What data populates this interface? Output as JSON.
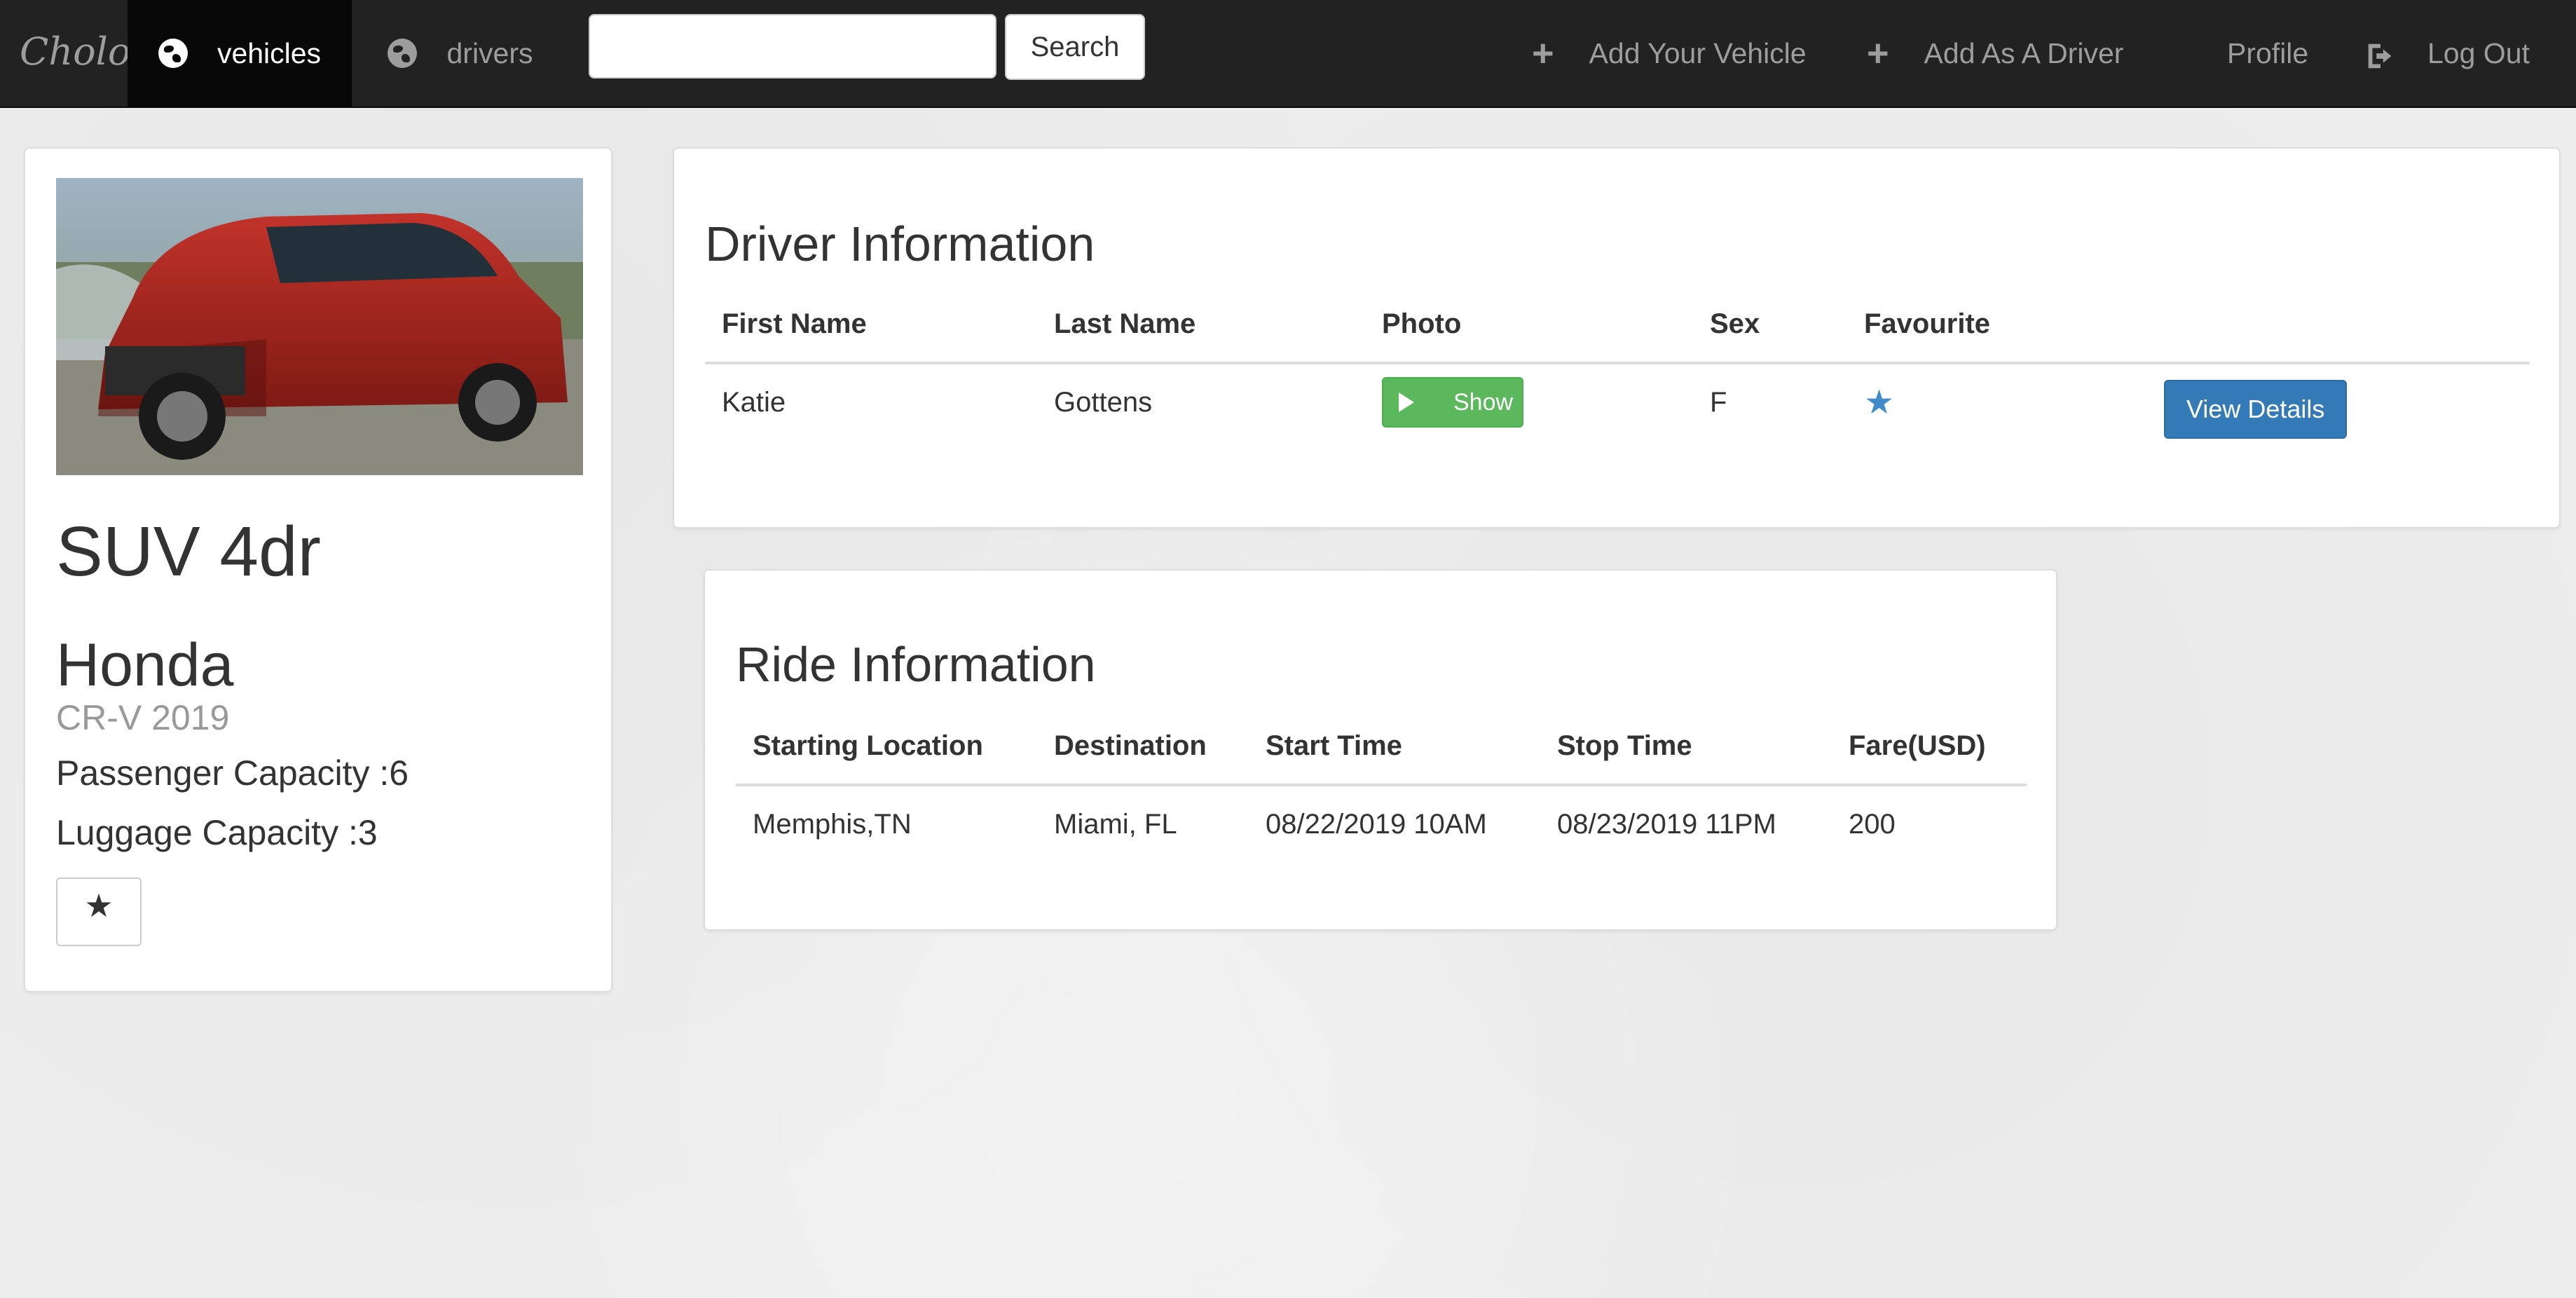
{
  "navbar": {
    "brand": "Cholo",
    "items": [
      {
        "label": "vehicles",
        "icon": "globe-icon",
        "active": true
      },
      {
        "label": "drivers",
        "icon": "globe-icon",
        "active": false
      }
    ],
    "search": {
      "placeholder": "",
      "value": "",
      "button_label": "Search"
    },
    "right_items": [
      {
        "label": "Add Your Vehicle",
        "icon": "plus-icon"
      },
      {
        "label": "Add As A Driver",
        "icon": "plus-icon"
      },
      {
        "label": "Profile"
      },
      {
        "label": "Log Out",
        "icon": "logout-icon"
      }
    ]
  },
  "vehicle": {
    "image": "car-photo (red Honda CR-V)",
    "title": "SUV 4dr",
    "make": "Honda",
    "model": "CR-V 2019",
    "passenger_capacity": "Passenger Capacity :6",
    "luggage_capacity": "Luggage Capacity :3",
    "favourite_symbol": "★"
  },
  "driver_info": {
    "title": "Driver Information",
    "columns": [
      "First Name",
      "Last Name",
      "Photo",
      "Sex",
      "Favourite",
      ""
    ],
    "rows": [
      {
        "first_name": "Katie",
        "last_name": "Gottens",
        "photo_button": "Show",
        "sex": "F",
        "favourite": "★",
        "action": "View Details"
      }
    ]
  },
  "ride_info": {
    "title": "Ride Information",
    "columns": [
      "Starting Location",
      "Destination",
      "Start Time",
      "Stop Time",
      "Fare(USD)"
    ],
    "rows": [
      {
        "start": "Memphis,TN",
        "destination": "Miami, FL",
        "start_time": "08/22/2019 10AM",
        "stop_time": "08/23/2019 11PM",
        "fare": "200"
      }
    ]
  },
  "colors": {
    "navbar_bg": "#222222",
    "active_bg": "#080808",
    "success": "#5cb85c",
    "primary": "#337ab7",
    "star_blue": "#428bca"
  }
}
